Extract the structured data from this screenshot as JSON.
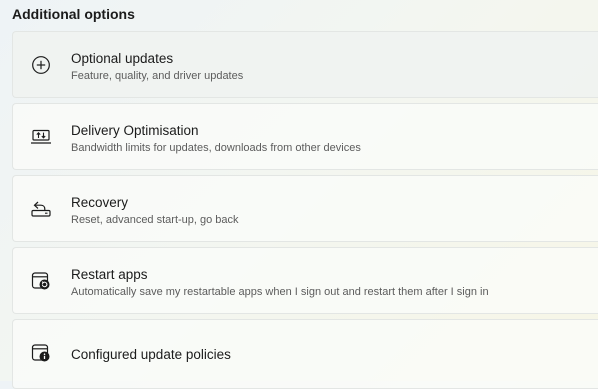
{
  "section": {
    "title": "Additional options"
  },
  "options": [
    {
      "title": "Optional updates",
      "description": "Feature, quality, and driver updates",
      "icon": "plus-circle-icon"
    },
    {
      "title": "Delivery Optimisation",
      "description": "Bandwidth limits for updates, downloads from other devices",
      "icon": "delivery-optimisation-icon"
    },
    {
      "title": "Recovery",
      "description": "Reset, advanced start-up, go back",
      "icon": "recovery-icon"
    },
    {
      "title": "Restart apps",
      "description": "Automatically save my restartable apps when I sign out and restart them after I sign in",
      "icon": "restart-apps-icon"
    },
    {
      "title": "Configured update policies",
      "icon": "update-policies-icon"
    }
  ]
}
